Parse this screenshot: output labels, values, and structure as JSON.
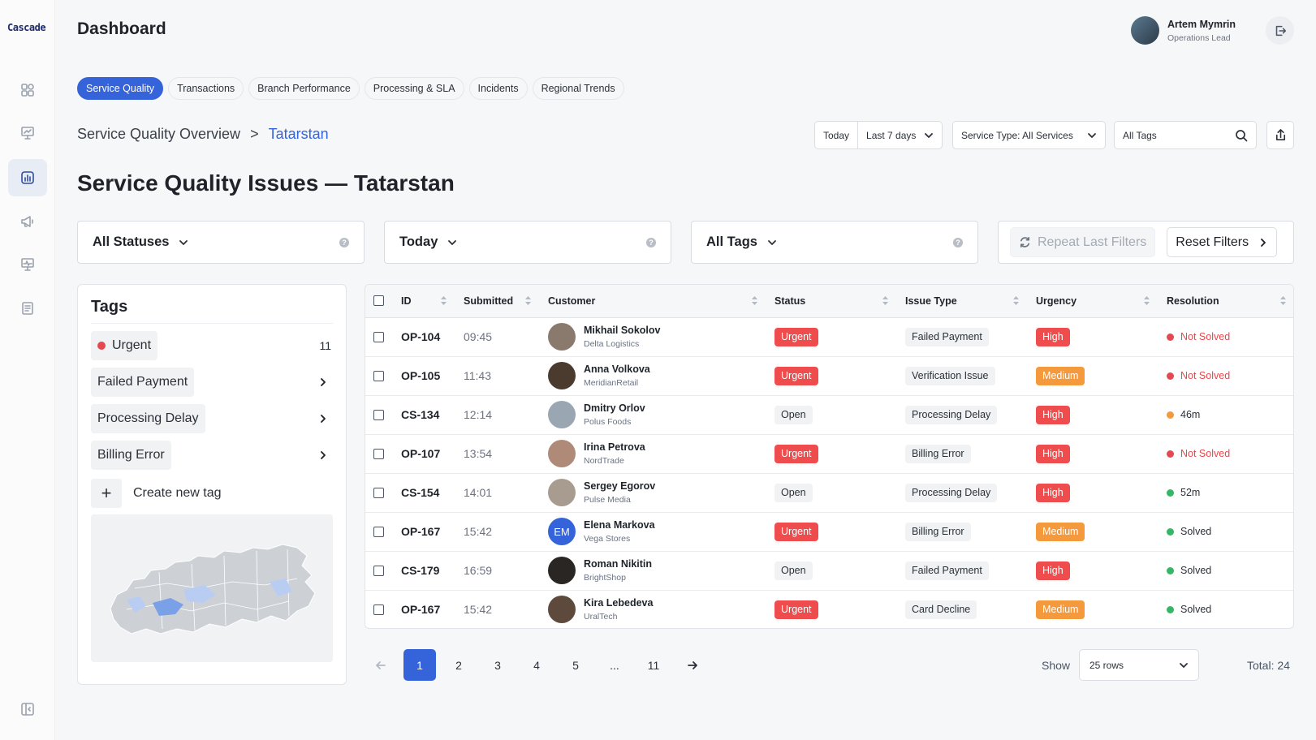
{
  "app": {
    "logo": "Cascade",
    "title": "Dashboard"
  },
  "user": {
    "name": "Artem Mymrin",
    "role": "Operations Lead"
  },
  "rail": {
    "items": [
      "grid-icon",
      "presentation-icon",
      "analytics-icon",
      "megaphone-icon",
      "monitor-icon",
      "document-icon"
    ],
    "collapse": "collapse-sidebar-icon"
  },
  "tabs": [
    {
      "label": "Service Quality",
      "active": true
    },
    {
      "label": "Transactions"
    },
    {
      "label": "Branch Performance"
    },
    {
      "label": "Processing & SLA"
    },
    {
      "label": "Incidents"
    },
    {
      "label": "Regional Trends"
    }
  ],
  "breadcrumb": {
    "parent": "Service Quality Overview",
    "separator": ">",
    "current": "Tatarstan"
  },
  "top_filters": {
    "today": "Today",
    "range": "Last 7 days",
    "service_type": "Service Type: All Services",
    "tags_placeholder": "All Tags"
  },
  "section_title": "Service Quality Issues — Tatarstan",
  "filters": {
    "statuses": "All Statuses",
    "date": "Today",
    "tags": "All Tags",
    "help": "?",
    "repeat": "Repeat Last Filters",
    "reset": "Reset Filters"
  },
  "tags_panel": {
    "title": "Tags",
    "items": [
      {
        "label": "Urgent",
        "count": "11",
        "dot": "#e5484d"
      },
      {
        "label": "Failed Payment"
      },
      {
        "label": "Processing Delay"
      },
      {
        "label": "Billing Error"
      }
    ],
    "create_plus": "+",
    "create_label": "Create new tag"
  },
  "table": {
    "headers": [
      "ID",
      "Submitted",
      "Customer",
      "Status",
      "Issue Type",
      "Urgency",
      "Resolution"
    ],
    "rows": [
      {
        "id": "OP-104",
        "submitted": "09:45",
        "name": "Mikhail Sokolov",
        "company": "Delta Logistics",
        "status": "Urgent",
        "issue": "Failed Payment",
        "urgency": "High",
        "resolution": "Not Solved",
        "res": "red",
        "avatar": "#8a7a6e"
      },
      {
        "id": "OP-105",
        "submitted": "11:43",
        "name": "Anna Volkova",
        "company": "MeridianRetail",
        "status": "Urgent",
        "issue": "Verification Issue",
        "urgency": "Medium",
        "resolution": "Not Solved",
        "res": "red",
        "avatar": "#4b3a2e"
      },
      {
        "id": "CS-134",
        "submitted": "12:14",
        "name": "Dmitry Orlov",
        "company": "Polus Foods",
        "status": "Open",
        "issue": "Processing Delay",
        "urgency": "High",
        "resolution": "46m",
        "res": "orange",
        "avatar": "#9aa6b2"
      },
      {
        "id": "OP-107",
        "submitted": "13:54",
        "name": "Irina Petrova",
        "company": "NordTrade",
        "status": "Urgent",
        "issue": "Billing Error",
        "urgency": "High",
        "resolution": "Not Solved",
        "res": "red",
        "avatar": "#b08a78"
      },
      {
        "id": "CS-154",
        "submitted": "14:01",
        "name": "Sergey Egorov",
        "company": "Pulse Media",
        "status": "Open",
        "issue": "Processing Delay",
        "urgency": "High",
        "resolution": "52m",
        "res": "green",
        "avatar": "#a89c90"
      },
      {
        "id": "OP-167",
        "submitted": "15:42",
        "name": "Elena Markova",
        "company": "Vega Stores",
        "status": "Urgent",
        "issue": "Billing Error",
        "urgency": "Medium",
        "resolution": "Solved",
        "res": "green",
        "avatar": "#3563d9",
        "initials": "EM"
      },
      {
        "id": "CS-179",
        "submitted": "16:59",
        "name": "Roman Nikitin",
        "company": "BrightShop",
        "status": "Open",
        "issue": "Failed Payment",
        "urgency": "High",
        "resolution": "Solved",
        "res": "green",
        "avatar": "#2a2624"
      },
      {
        "id": "OP-167",
        "submitted": "15:42",
        "name": "Kira Lebedeva",
        "company": "UralTech",
        "status": "Urgent",
        "issue": "Card Decline",
        "urgency": "Medium",
        "resolution": "Solved",
        "res": "green",
        "avatar": "#5d4a3c"
      }
    ]
  },
  "pagination": {
    "pages": [
      "1",
      "2",
      "3",
      "4",
      "5",
      "...",
      "11"
    ],
    "active": "1",
    "show_label": "Show",
    "rows_value": "25 rows",
    "total": "Total: 24"
  },
  "colors": {
    "accent": "#3563d9",
    "danger": "#ef4d4d",
    "warning": "#f59a3c",
    "success": "#33b866"
  }
}
